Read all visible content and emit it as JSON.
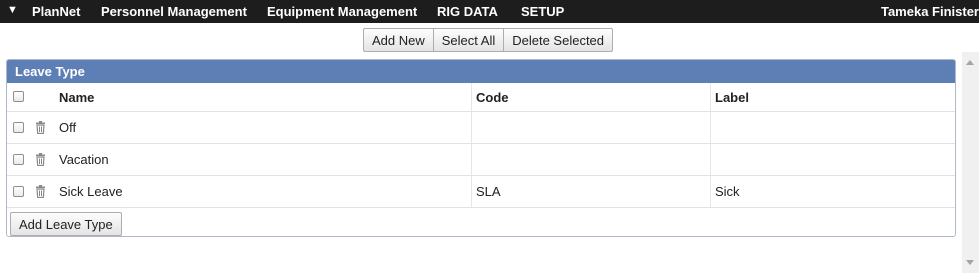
{
  "nav": {
    "menu_glyph": "▼",
    "items": [
      "PlanNet",
      "Personnel Management",
      "Equipment Management",
      "RIG DATA",
      "SETUP"
    ],
    "user": "Tameka Finister"
  },
  "toolbar": {
    "add_new": "Add New",
    "select_all": "Select All",
    "delete_selected": "Delete Selected"
  },
  "panel": {
    "title": "Leave Type",
    "columns": {
      "name": "Name",
      "code": "Code",
      "label": "Label"
    },
    "rows": [
      {
        "name": "Off",
        "code": "",
        "label": ""
      },
      {
        "name": "Vacation",
        "code": "",
        "label": ""
      },
      {
        "name": "Sick Leave",
        "code": "SLA",
        "label": "Sick"
      }
    ],
    "add_button": "Add Leave Type"
  },
  "icons": {
    "row_delete": "trash-icon",
    "menu": "chevron-down-icon"
  },
  "colors": {
    "nav_bg": "#1d1d1d",
    "panel_header": "#5d7fb5"
  }
}
